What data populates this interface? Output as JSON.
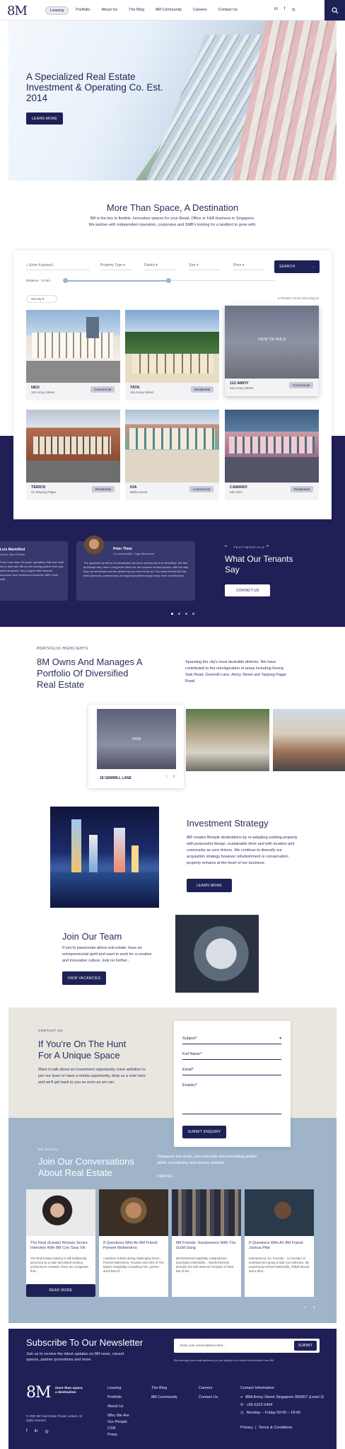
{
  "nav": {
    "links": [
      "Leasing",
      "Portfolio",
      "About Us",
      "The Blog",
      "8M Community",
      "Careers",
      "Contact Us"
    ],
    "social": [
      "in",
      "f",
      "◎"
    ],
    "search_icon": "search-icon"
  },
  "hero": {
    "title": "A Specialized Real Estate Investment & Operating Co. Est. 2014",
    "cta": "LEARN MORE"
  },
  "intro": {
    "title": "More Than Space, A Destination",
    "line1": "8M is the key to flexible, innovative spaces for your Retail, Office or F&B business in Singapore.",
    "line2": "We partner with independent operators, corporates and SMB's looking for a landlord to grow with."
  },
  "search": {
    "keyword_placeholder": "Enter Keyword...",
    "filters": [
      "Property Type",
      "District",
      "Size",
      "Price"
    ],
    "button": "SEARCH",
    "distance_label": "Distance - 10 km",
    "sort": "Sort By",
    "results": "6 Results Found (Showing 6)",
    "view_details": "VIEW DETAILS"
  },
  "properties": [
    {
      "name": "NEO",
      "address": "115 Amoy Street",
      "tag": "Commercial"
    },
    {
      "name": "TATA",
      "address": "115 Amoy Street",
      "tag": "Residential"
    },
    {
      "name": "112 AMOY",
      "address": "115 Amoy Street",
      "tag": "Commercial"
    },
    {
      "name": "TERIOS",
      "address": "21 Tanjong Pagar",
      "tag": "Residential"
    },
    {
      "name": "KIA",
      "address": "Bella House",
      "tag": "Commercial"
    },
    {
      "name": "CAMARO",
      "address": "KIE ADH",
      "tag": "Residential"
    }
  ],
  "testimonials": {
    "eyebrow": "TESTIMONIALS",
    "title": "What Our Tenants Say",
    "cta": "CONTACT US",
    "cards": [
      {
        "name": "Luis Marmillod",
        "role": "Owner, Bar KiTchen",
        "text": "From more than 20 years' operating F&B and retail we to deal with 8M as our leasing partner than any other landlords, they support their tenants' exposure and continuous business, 8M's more with."
      },
      {
        "name": "Peter Thew",
        "role": "Co-founder/MD, Yoga Movement",
        "text": "The approach by 8M to our tenancies has been nothing short of refreshing. We feel as though they have a long-term vision for the success of their spaces, with the way they mix tenancies and the detail they put into the fit-out. The team behind 8M has been pleasant, professional, and approachable through every level of interaction."
      }
    ]
  },
  "portfolio": {
    "eyebrow": "PORTFOLIO HIGHLIGHTS",
    "title": "8M Owns And Manages A Portfolio Of Diversified Real Estate",
    "text": "Spanning the city's most desirable districts. We have contributed to the reinvigoration of areas including Keong Saik Road, Gemmill Lane, Amoy Street and Tanjong Pagar Road.",
    "slide_label": "18 GEMMILL LANE",
    "view": "VIEW"
  },
  "strategy": {
    "title": "Investment Strategy",
    "text": "8M creates lifestyle destinations by re-adapting existing property with purposeful design, sustainable drive and with location and community as core drivers. We continue to diversify our acquisition strategy however refurbishment or conservation property remains at the heart of our business.",
    "cta": "LEARN MORE"
  },
  "team": {
    "title": "Join Our Team",
    "text": "If you're passionate about real estate, have an entrepreneurial spirit and want to work for a creative and innovative culture, look no further...",
    "cta": "VIEW VACANCIES"
  },
  "enquiry": {
    "eyebrow": "CONTACT US",
    "title": "If You're On The Hunt For A Unique Space",
    "text": "Want to talk about an investment opportunity, have ambition to join our team or have a media opportunity, drop us a note here and we'll get back to you as soon as we can.",
    "subject": "Subject",
    "full_name": "Full Name",
    "email": "Email",
    "enquiry": "Enquiry",
    "button": "SUBMIT ENQUIRY"
  },
  "blog": {
    "eyebrow": "8M SOCIAL",
    "title": "Join Our Conversations About Real Estate",
    "text": "Singapore hot spots, cool concepts and interesting people within our industry and diverse network.",
    "view_all": "VIEW ALL",
    "read_more": "READ MORE",
    "articles": [
      {
        "title": "The Real (Estate) Women Series: Interview With 8M Coo Sara Viti",
        "text": "The Real Estate Industry is still traditionally perceived as a male dominated working environment. However, there are companies that..."
      },
      {
        "title": "8 Questions With An 8M Friend: Pymeet Mahendros",
        "text": "A positive outlook during challenging times... Pymeet Mahendros, Founder and CEO of The Martini Hospitality Consulting Firm, partner and friend of..."
      },
      {
        "title": "8M Friends: Sundowners With The Guild Gang",
        "text": "8M fashioned hospitality, restaurateurs, downright comfortable... Words that best describe the well deserved recipient of 'Best Bar of the..."
      },
      {
        "title": "8 Questions With An 8M Friend: Joshua Pitie",
        "text": "Entrepreneur, DJ, Founder... Co-founder of entertainment group & Mail Cat Collective, the powerhouse behind Netherhillz, Pitbull Wizard and a third..."
      }
    ]
  },
  "newsletter": {
    "title": "Subscribe To Our Newsletter",
    "text": "Join us to receive the latest updates on 8M news, vacant spaces, partner promotions and more.",
    "placeholder": "Enter your email address here...",
    "button": "SUBMIT",
    "disclaimer": "By entering your email address you are opting in to receive information from 8M."
  },
  "footer": {
    "tagline": "more than space, a destination",
    "copyright": "© 2020 8M Real Estate Private Limited. All rights reserved.",
    "col1": [
      "Leasing",
      "Portfolio",
      "About Us",
      "Who We Are",
      "Our People",
      "CSR",
      "Press"
    ],
    "col2": [
      "The Blog",
      "8M Community"
    ],
    "col3": [
      "Careers",
      "Contact Us"
    ],
    "contact_title": "Contact Information",
    "address": "8BA Amoy Street Singapore 069907 (Level 2)",
    "phone": "+65 6323 0454",
    "hours": "Monday – Friday 09:00 – 18:00",
    "privacy": "Privacy",
    "terms": "Terms & Conditions"
  }
}
